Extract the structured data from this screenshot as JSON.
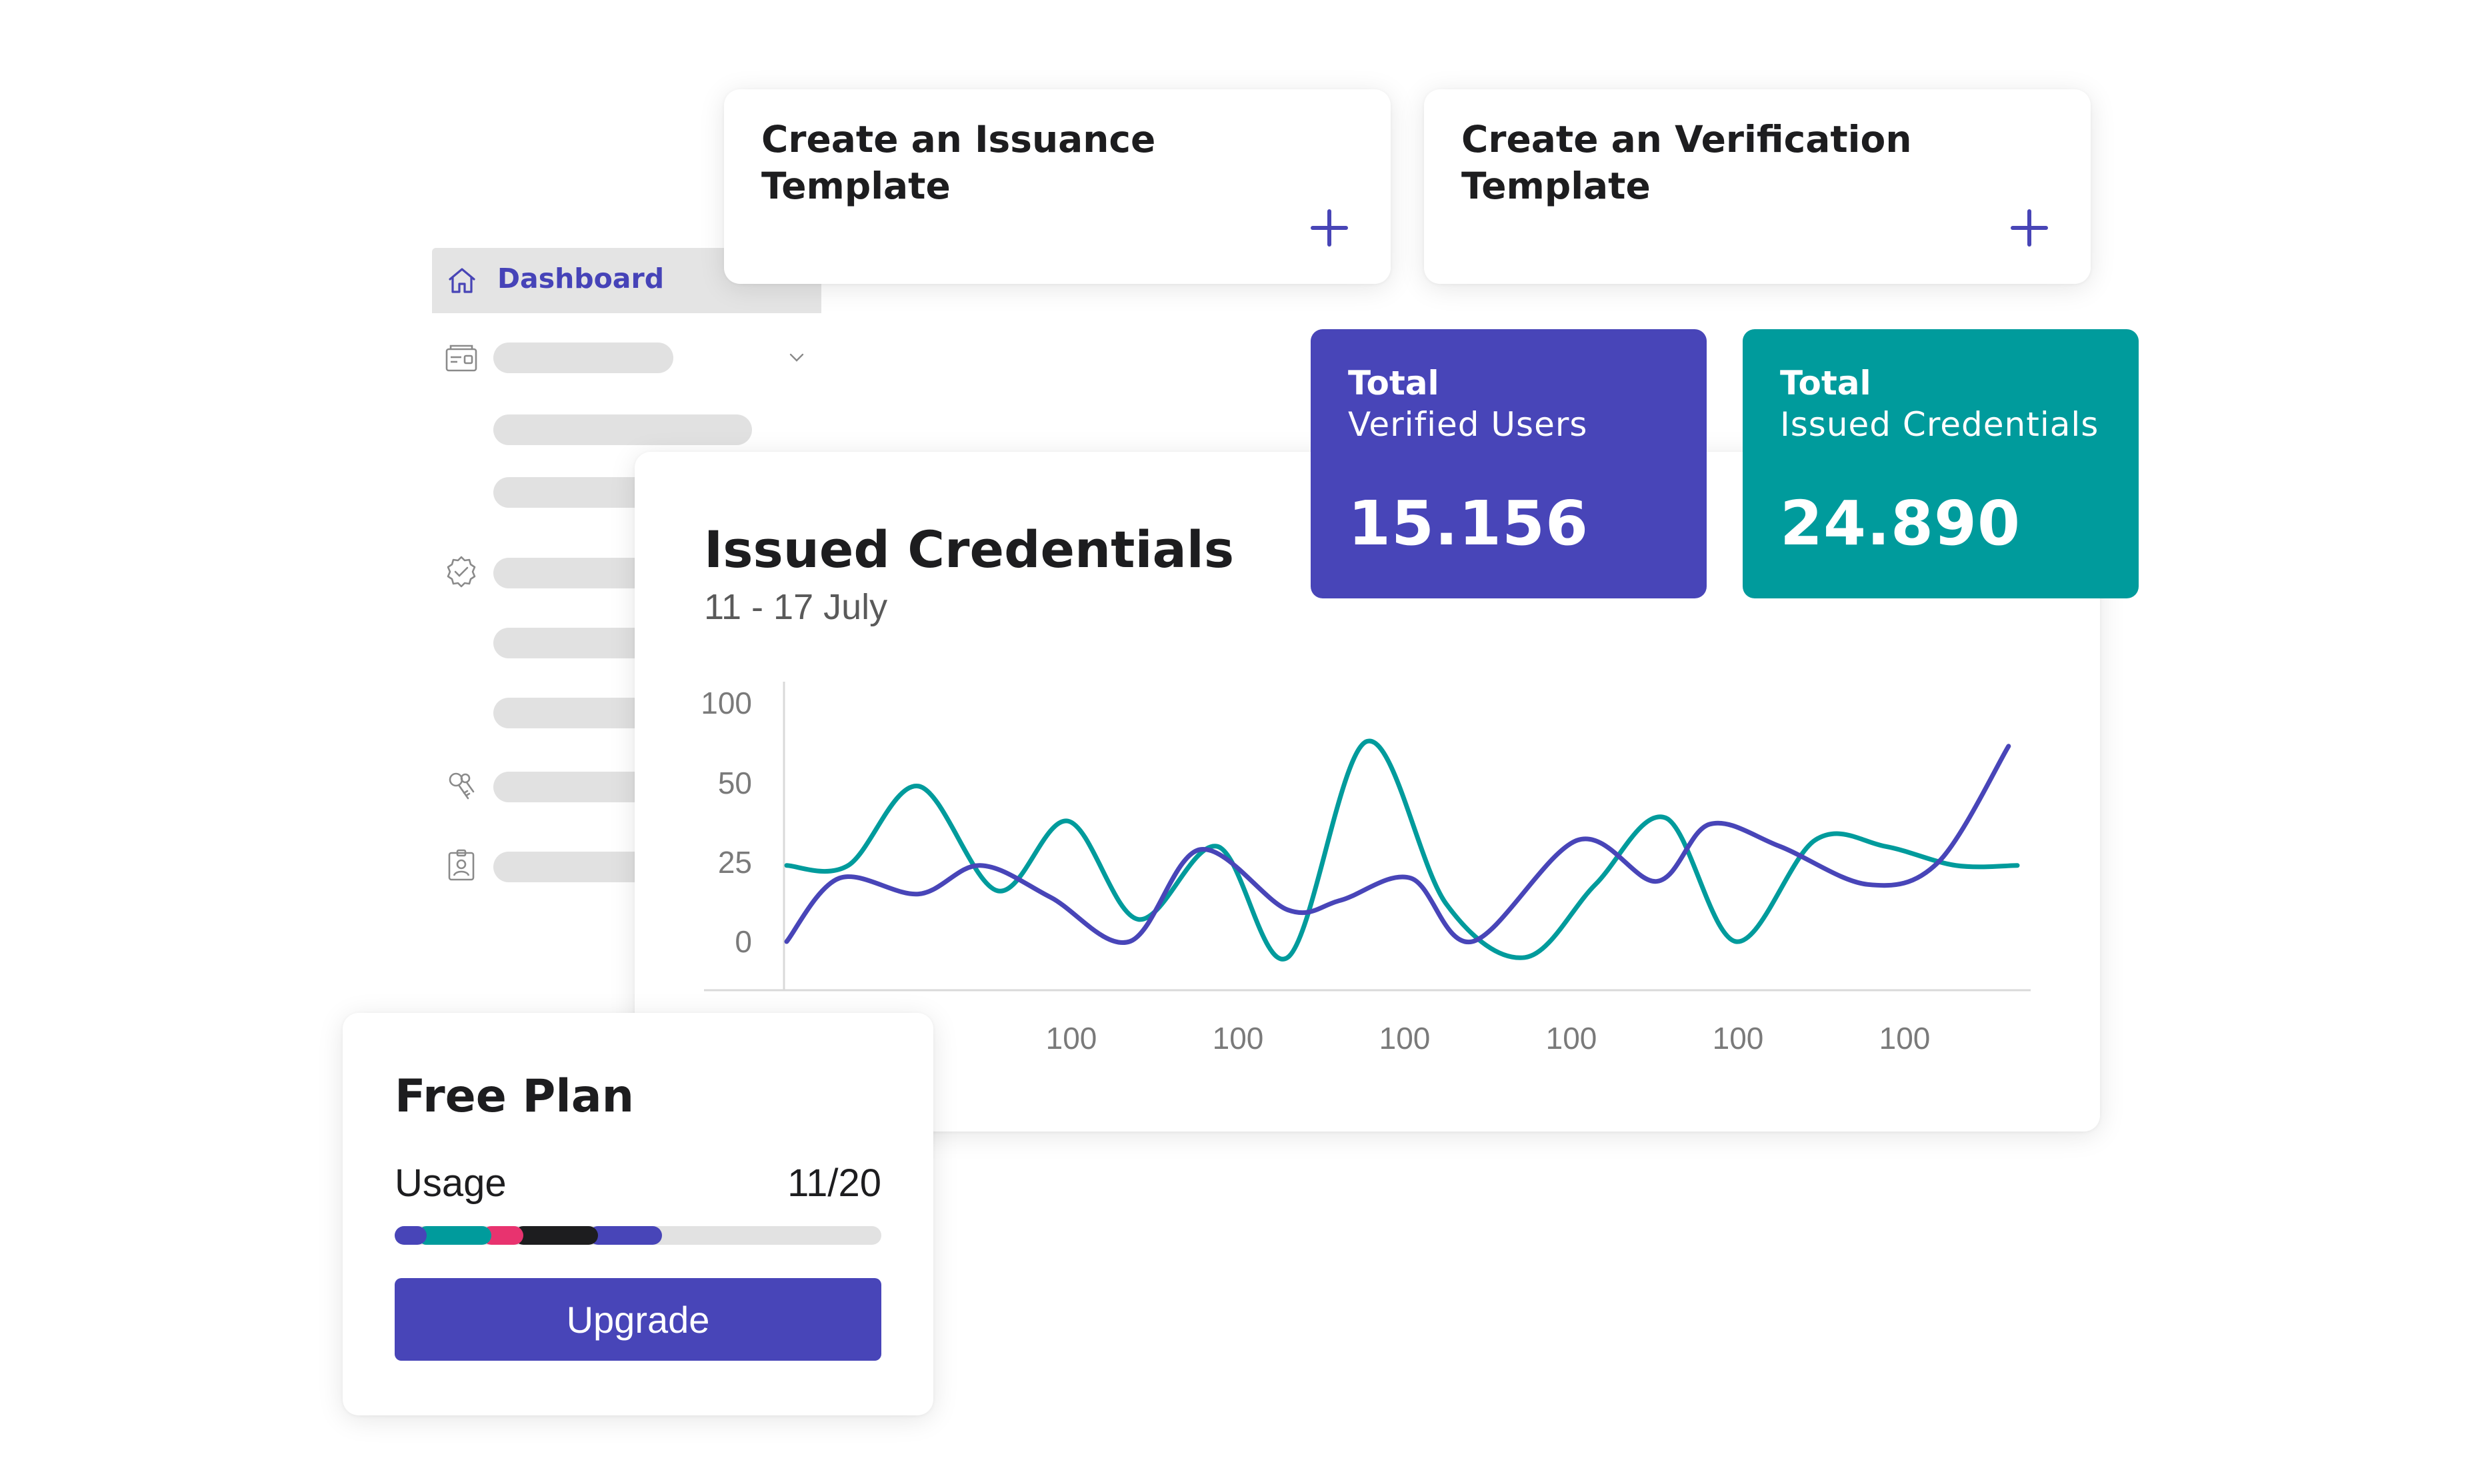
{
  "sidebar": {
    "active_item": {
      "label": "Dashboard",
      "icon": "home-icon"
    },
    "section_icons": [
      "credentials-card-icon",
      "verified-badge-icon",
      "keys-icon",
      "id-badge-icon"
    ]
  },
  "templates": [
    {
      "title": "Create an Issuance Template",
      "action_icon": "plus-icon"
    },
    {
      "title": "Create an Verification Template",
      "action_icon": "plus-icon"
    }
  ],
  "stats": [
    {
      "label_bold": "Total",
      "label": "Verified Users",
      "value": "15.156",
      "color": "#4845b8"
    },
    {
      "label_bold": "Total",
      "label": "Issued Credentials",
      "value": "24.890",
      "color": "#009b9c"
    }
  ],
  "chart": {
    "title": "Issued Credentials",
    "subtitle": "11 - 17 July"
  },
  "chart_data": {
    "type": "line",
    "title": "Issued Credentials",
    "subtitle": "11 - 17 July",
    "y_ticks": [
      "100",
      "50",
      "25",
      "0"
    ],
    "x_ticks": [
      "100",
      "100",
      "100",
      "100",
      "100",
      "100",
      "100"
    ],
    "ylim": [
      0,
      100
    ],
    "grid": false,
    "series": [
      {
        "color": "#009b9c",
        "x": [
          0,
          0.35,
          0.75,
          1.2,
          1.6,
          2.0,
          2.45,
          2.85,
          3.3,
          3.75,
          4.2,
          4.6,
          5.0,
          5.4,
          5.85,
          6.25,
          6.65,
          7.0
        ],
        "y": [
          24,
          24,
          49,
          16,
          38,
          7,
          30,
          -5,
          76,
          12,
          -5,
          18,
          39,
          0,
          32,
          30,
          24,
          24
        ]
      },
      {
        "color": "#4845b8",
        "x": [
          0,
          0.3,
          0.75,
          1.1,
          1.5,
          1.95,
          2.35,
          2.85,
          3.15,
          3.55,
          3.9,
          4.5,
          4.95,
          5.25,
          5.65,
          6.15,
          6.55,
          6.95
        ],
        "y": [
          0,
          20,
          15,
          24,
          14,
          0,
          29,
          10,
          13,
          20,
          0,
          32,
          19,
          37,
          30,
          18,
          25,
          73
        ]
      }
    ]
  },
  "plan": {
    "title": "Free Plan",
    "usage_label": "Usage",
    "usage_value": "11/20",
    "usage_fraction": 0.55,
    "usage_segment_colors": [
      "#4845b8",
      "#009b9c",
      "#e8336f",
      "#1d1d1f",
      "#4845b8"
    ],
    "button_label": "Upgrade",
    "button_color": "#4845b8"
  }
}
